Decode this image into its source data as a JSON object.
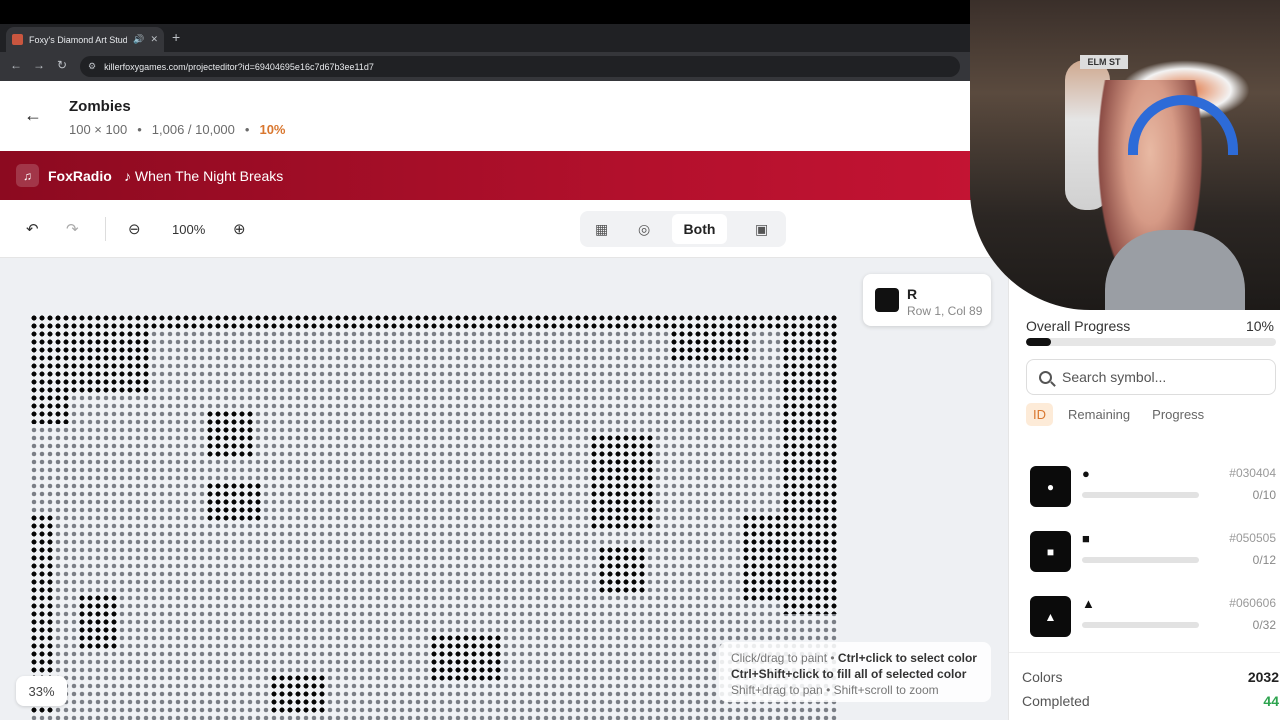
{
  "browser": {
    "tab_title": "Foxy's Diamond Art Studio",
    "url": "killerfoxygames.com/projecteditor?id=69404695e16c7d67b3ee11d7"
  },
  "header": {
    "title": "Zombies",
    "dimensions": "100 × 100",
    "placed": "1,006 / 10,000",
    "percent": "10%"
  },
  "radio": {
    "brand": "FoxRadio",
    "track": "♪ When The Night Breaks"
  },
  "toolbar": {
    "zoom": "100%",
    "view_mode": "Both"
  },
  "canvas": {
    "cell_symbol": "R",
    "cell_position": "Row 1, Col 89",
    "help_line1_a": "Click/drag to paint • ",
    "help_line1_b": "Ctrl+click to select color",
    "help_line2": "Ctrl+Shift+click to fill all of selected color",
    "help_line3": "Shift+drag to pan • Shift+scroll to zoom",
    "zoom_pill": "33%"
  },
  "sidebar": {
    "progress_label": "Overall Progress",
    "progress_value": "10%",
    "progress_fraction": 0.1,
    "search_placeholder": "Search symbol...",
    "sort_tabs": [
      "ID",
      "Remaining",
      "Progress"
    ],
    "colors": [
      {
        "symbol": "●",
        "hex": "#030404",
        "count": "0/10"
      },
      {
        "symbol": "■",
        "hex": "#050505",
        "count": "0/12"
      },
      {
        "symbol": "▲",
        "hex": "#060606",
        "count": "0/32"
      }
    ],
    "stats": {
      "colors_label": "Colors",
      "colors_value": "2032",
      "completed_label": "Completed",
      "completed_value": "44"
    }
  },
  "webcam": {
    "sign_text": "ELM ST"
  }
}
